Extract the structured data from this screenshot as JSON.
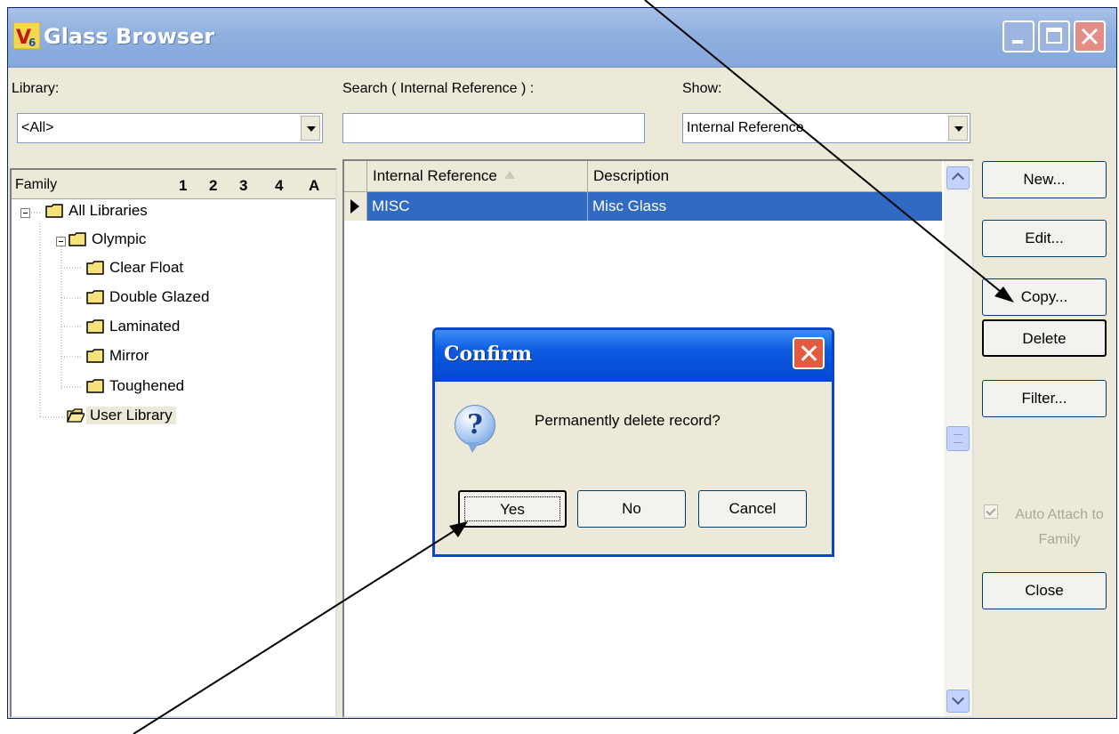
{
  "window": {
    "title": "Glass Browser",
    "controls": [
      "minimize-icon",
      "maximize-icon",
      "close-icon"
    ]
  },
  "filters": {
    "library_label": "Library:",
    "library_value": "<All>",
    "search_label": "Search ( Internal Reference ) :",
    "search_value": "",
    "show_label": "Show:",
    "show_value": "Internal Reference"
  },
  "family": {
    "header": "Family",
    "levels": [
      "1",
      "2",
      "3",
      "4",
      "A"
    ],
    "tree": {
      "root": "All Libraries",
      "olympic": "Olympic",
      "children": [
        "Clear Float",
        "Double Glazed",
        "Laminated",
        "Mirror",
        "Toughened"
      ],
      "user_library": "User Library"
    }
  },
  "grid": {
    "columns": [
      "Internal Reference",
      "Description"
    ],
    "rows": [
      {
        "reference": "MISC",
        "description": "Misc Glass"
      }
    ]
  },
  "buttons": {
    "new": "New...",
    "edit": "Edit...",
    "copy": "Copy...",
    "delete": "Delete",
    "filter": "Filter...",
    "close": "Close"
  },
  "auto_attach": {
    "label": "Auto Attach to Family",
    "checked": true,
    "enabled": false
  },
  "dialog": {
    "title": "Confirm",
    "message": "Permanently delete record?",
    "icon": "question-icon",
    "buttons": {
      "yes": "Yes",
      "no": "No",
      "cancel": "Cancel"
    }
  },
  "colors": {
    "selection": "#316ac5",
    "dialog_titlebar": "#0548d3",
    "window_face": "#ece9d8"
  }
}
